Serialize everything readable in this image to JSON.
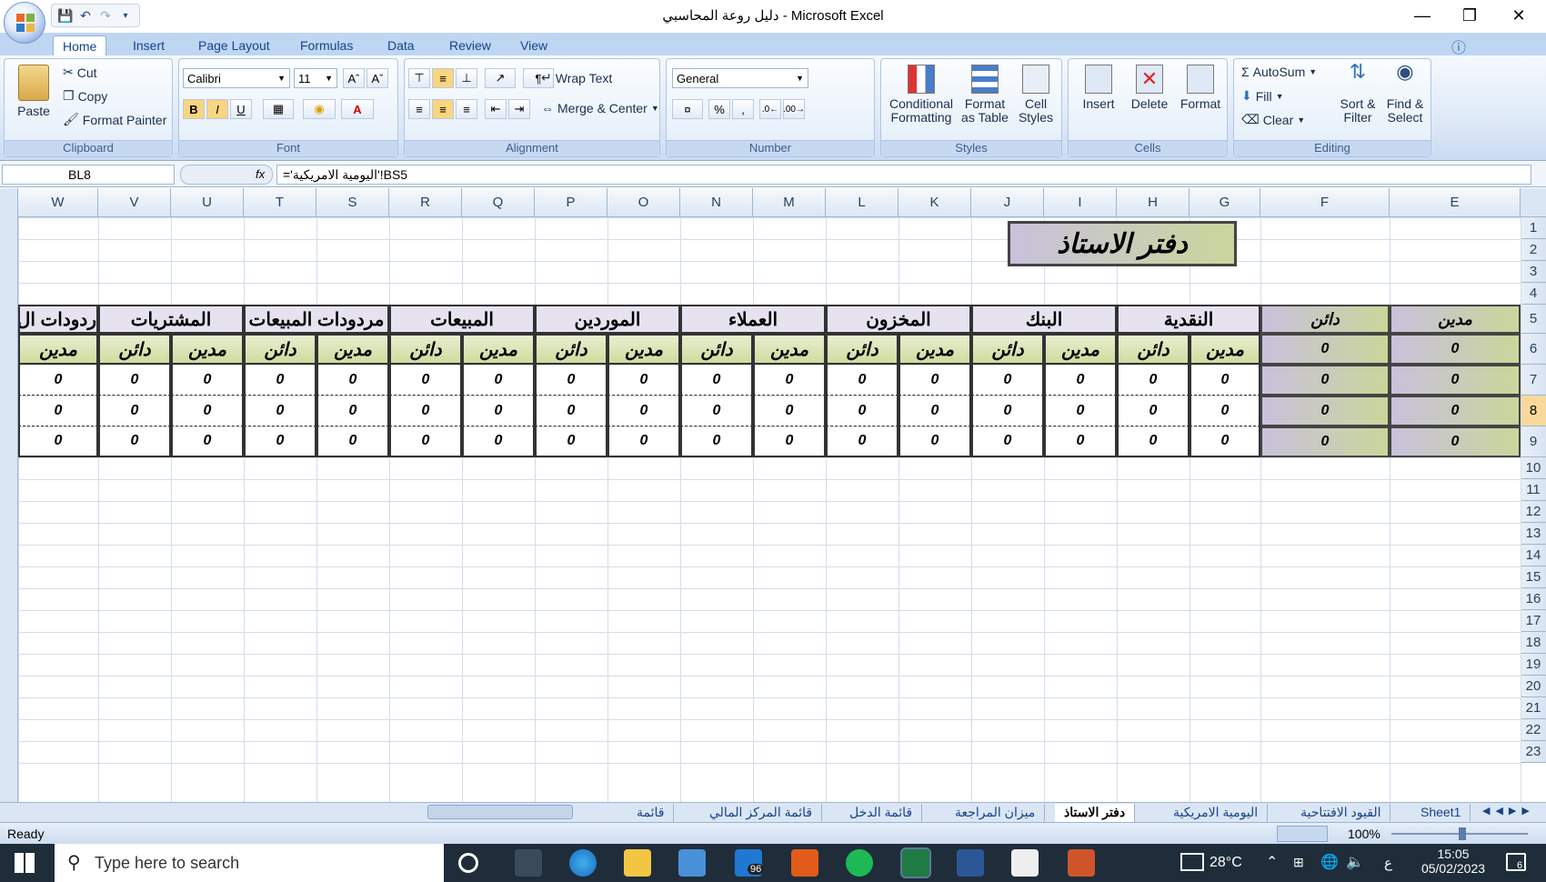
{
  "window": {
    "title": "دليل روعة المحاسبي - Microsoft Excel"
  },
  "ribbon_tabs": [
    "Home",
    "Insert",
    "Page Layout",
    "Formulas",
    "Data",
    "Review",
    "View"
  ],
  "clipboard": {
    "paste": "Paste",
    "cut": "Cut",
    "copy": "Copy",
    "format_painter": "Format Painter",
    "label": "Clipboard"
  },
  "font": {
    "name": "Calibri",
    "size": "11",
    "bold": "B",
    "italic": "I",
    "underline": "U",
    "label": "Font"
  },
  "alignment": {
    "wrap": "Wrap Text",
    "merge": "Merge & Center",
    "label": "Alignment"
  },
  "number": {
    "format": "General",
    "percent": "%",
    "comma": ",",
    "label": "Number"
  },
  "styles": {
    "conditional": "Conditional",
    "conditional2": "Formatting",
    "format_table": "Format",
    "format_table2": "as Table",
    "cell_styles": "Cell",
    "cell_styles2": "Styles",
    "label": "Styles"
  },
  "cells": {
    "insert": "Insert",
    "delete": "Delete",
    "format": "Format",
    "label": "Cells"
  },
  "editing": {
    "autosum": "AutoSum",
    "fill": "Fill",
    "clear": "Clear",
    "sort": "Sort &",
    "sort2": "Filter",
    "find": "Find &",
    "find2": "Select",
    "label": "Editing"
  },
  "formula_bar": {
    "name_box": "BL8",
    "fx": "fx",
    "formula": "='اليومية الامريكية'!BS5"
  },
  "columns": [
    "W",
    "V",
    "U",
    "T",
    "S",
    "R",
    "Q",
    "P",
    "O",
    "N",
    "M",
    "L",
    "K",
    "J",
    "I",
    "H",
    "G",
    "F",
    "E"
  ],
  "rows": [
    "1",
    "2",
    "3",
    "4",
    "5",
    "6",
    "7",
    "8",
    "9",
    "10",
    "11",
    "12",
    "13",
    "14",
    "15",
    "16",
    "17",
    "18",
    "19",
    "20",
    "21",
    "22",
    "23"
  ],
  "sheet": {
    "title": "دفتر الاستاذ",
    "right_headers": [
      "مدين",
      "دائن"
    ],
    "right_values": [
      "0",
      "0",
      "0",
      "0"
    ],
    "account_headers": [
      "النقدية",
      "البنك",
      "المخزون",
      "العملاء",
      "الموردين",
      "المبيعات",
      "مردودات المبيعات",
      "المشتريات",
      "ردودات ال"
    ],
    "debit": "مدين",
    "credit": "دائن",
    "zero": "0"
  },
  "sheet_tabs": [
    "Sheet1",
    "القيود الافتتاحية",
    "اليومية الامريكية",
    "دفتر الاستاذ",
    "ميزان المراجعة",
    "قائمة الدخل",
    "قائمة المركز المالي",
    "قائمة"
  ],
  "status": {
    "ready": "Ready",
    "zoom": "100%"
  },
  "taskbar": {
    "search_placeholder": "Type here to search",
    "badge": "96",
    "temperature": "28°C",
    "lang": "ع",
    "time": "15:05",
    "date": "05/02/2023",
    "notif": "6"
  }
}
